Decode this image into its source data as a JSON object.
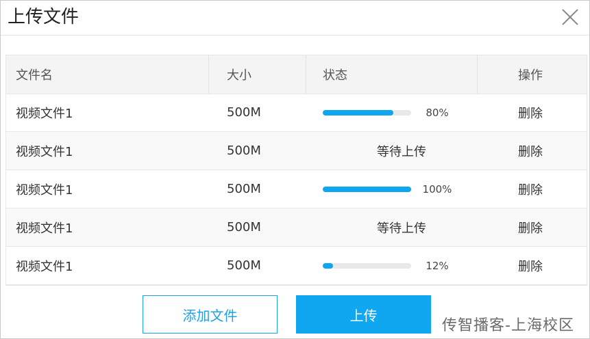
{
  "dialog": {
    "title": "上传文件"
  },
  "table": {
    "headers": [
      "文件名",
      "大小",
      "状态",
      "操作"
    ],
    "rows": [
      {
        "name": "视频文件1",
        "size": "500M",
        "status_type": "progress",
        "progress": 0.8,
        "percent_label": "80%",
        "action": "删除"
      },
      {
        "name": "视频文件1",
        "size": "500M",
        "status_type": "text",
        "status_text": "等待上传",
        "action": "删除"
      },
      {
        "name": "视频文件1",
        "size": "500M",
        "status_type": "progress",
        "progress": 1.0,
        "percent_label": "100%",
        "action": "删除"
      },
      {
        "name": "视频文件1",
        "size": "500M",
        "status_type": "text",
        "status_text": "等待上传",
        "action": "删除"
      },
      {
        "name": "视频文件1",
        "size": "500M",
        "status_type": "progress",
        "progress": 0.12,
        "percent_label": "12%",
        "action": "删除"
      }
    ]
  },
  "buttons": {
    "add_label": "添加文件",
    "upload_label": "上传"
  },
  "watermark": "传智播客-上海校区",
  "colors": {
    "accent": "#10a7f0",
    "progress_fill": "#0ea6ee",
    "progress_track": "#e9e9e9"
  },
  "icons": {
    "close": "close-icon"
  }
}
